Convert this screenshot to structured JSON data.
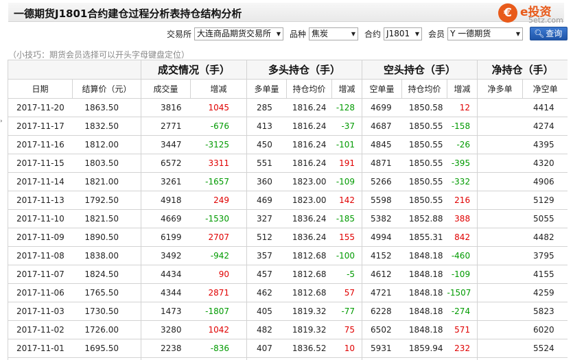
{
  "title": "一德期货J1801合约建仓过程分析表持仓结构分析",
  "logo": {
    "glyph": "€",
    "brand": "e投资",
    "sub": "5etz.com"
  },
  "filters": [
    {
      "label": "交易所",
      "value": "大连商品期货交易所"
    },
    {
      "label": "品种",
      "value": "焦炭"
    },
    {
      "label": "合约",
      "value": "J1801"
    },
    {
      "label": "会员",
      "value": "Y 一德期货"
    }
  ],
  "query_button": "查询",
  "tip": "（小技巧：期货会员选择可以开头字母键盘定位）",
  "table": {
    "groups": [
      "",
      "成交情况（手）",
      "多头持仓（手）",
      "空头持仓（手）",
      "净持仓（手）"
    ],
    "columns": [
      "日期",
      "结算价（元）",
      "成交量",
      "增减",
      "多单量",
      "持仓均价",
      "增减",
      "空单量",
      "持仓均价",
      "增减",
      "净多单",
      "净空单"
    ],
    "rows": [
      [
        "2017-11-20",
        "1863.50",
        "3816",
        "1045",
        "285",
        "1816.24",
        "-128",
        "4699",
        "1850.58",
        "12",
        "",
        "4414"
      ],
      [
        "2017-11-17",
        "1832.50",
        "2771",
        "-676",
        "413",
        "1816.24",
        "-37",
        "4687",
        "1850.55",
        "-158",
        "",
        "4274"
      ],
      [
        "2017-11-16",
        "1812.00",
        "3447",
        "-3125",
        "450",
        "1816.24",
        "-101",
        "4845",
        "1850.55",
        "-26",
        "",
        "4395"
      ],
      [
        "2017-11-15",
        "1803.50",
        "6572",
        "3311",
        "551",
        "1816.24",
        "191",
        "4871",
        "1850.55",
        "-395",
        "",
        "4320"
      ],
      [
        "2017-11-14",
        "1821.00",
        "3261",
        "-1657",
        "360",
        "1823.00",
        "-109",
        "5266",
        "1850.55",
        "-332",
        "",
        "4906"
      ],
      [
        "2017-11-13",
        "1792.50",
        "4918",
        "249",
        "469",
        "1823.00",
        "142",
        "5598",
        "1850.55",
        "216",
        "",
        "5129"
      ],
      [
        "2017-11-10",
        "1821.50",
        "4669",
        "-1530",
        "327",
        "1836.24",
        "-185",
        "5382",
        "1852.88",
        "388",
        "",
        "5055"
      ],
      [
        "2017-11-09",
        "1890.50",
        "6199",
        "2707",
        "512",
        "1836.24",
        "155",
        "4994",
        "1855.31",
        "842",
        "",
        "4482"
      ],
      [
        "2017-11-08",
        "1838.00",
        "3492",
        "-942",
        "357",
        "1812.68",
        "-100",
        "4152",
        "1848.18",
        "-460",
        "",
        "3795"
      ],
      [
        "2017-11-07",
        "1824.50",
        "4434",
        "90",
        "457",
        "1812.68",
        "-5",
        "4612",
        "1848.18",
        "-109",
        "",
        "4155"
      ],
      [
        "2017-11-06",
        "1765.50",
        "4344",
        "2871",
        "462",
        "1812.68",
        "57",
        "4721",
        "1848.18",
        "-1507",
        "",
        "4259"
      ],
      [
        "2017-11-03",
        "1730.50",
        "1473",
        "-1807",
        "405",
        "1819.32",
        "-77",
        "6228",
        "1848.18",
        "-274",
        "",
        "5823"
      ],
      [
        "2017-11-02",
        "1726.00",
        "3280",
        "1042",
        "482",
        "1819.32",
        "75",
        "6502",
        "1848.18",
        "571",
        "",
        "6020"
      ],
      [
        "2017-11-01",
        "1695.50",
        "2238",
        "-836",
        "407",
        "1836.52",
        "10",
        "5931",
        "1859.94",
        "232",
        "",
        "5524"
      ],
      [
        "",
        "",
        "",
        "",
        "",
        "",
        "",
        "",
        "",
        "",
        "",
        ""
      ]
    ]
  },
  "colors": {
    "increase": "#e00000",
    "decrease": "#009a00",
    "brand": "#e85a1a",
    "button": "#2a63b8"
  }
}
